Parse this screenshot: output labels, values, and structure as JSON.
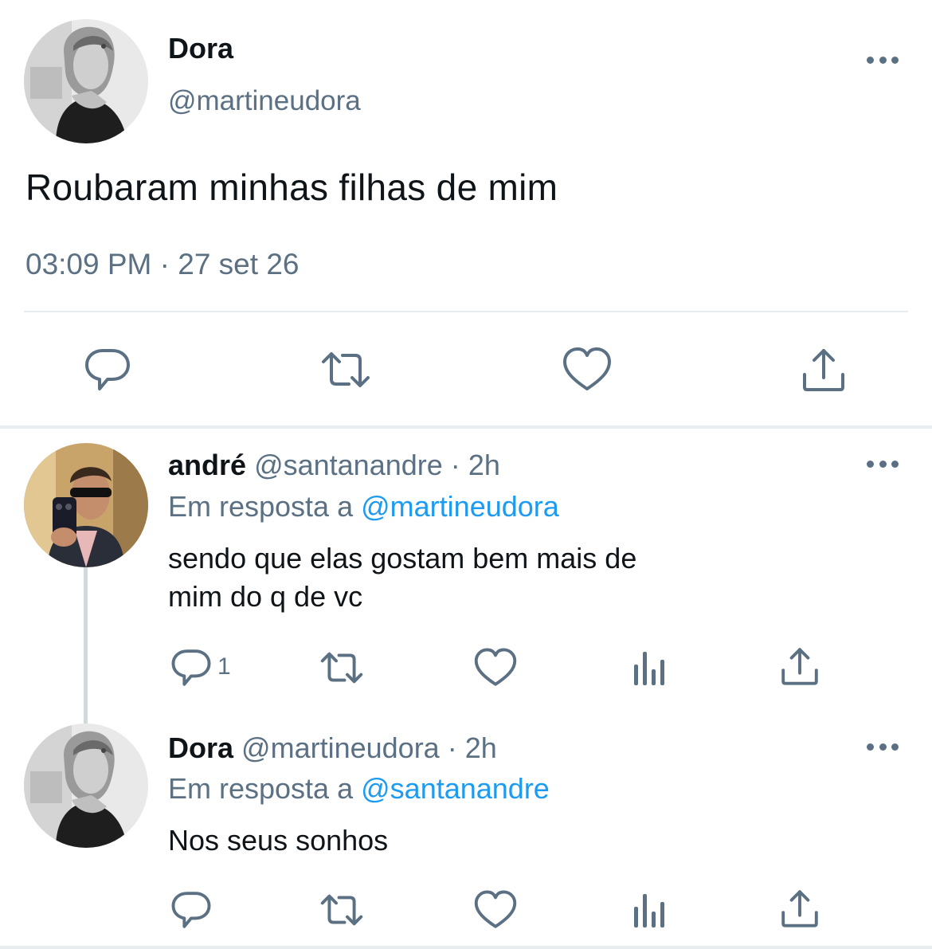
{
  "main_tweet": {
    "name": "Dora",
    "handle": "@martineudora",
    "text": "Roubaram minhas filhas de mim",
    "meta": "03:09 PM · 27 set 26",
    "actions": [
      "reply-icon",
      "retweet-icon",
      "like-icon",
      "share-icon"
    ]
  },
  "replies": [
    {
      "name": "andré",
      "handle": "@santanandre",
      "sep": "·",
      "time": "2h",
      "reply_prefix": "Em resposta a",
      "reply_to": "@martineudora",
      "text_lines": [
        "sendo que elas gostam bem mais de",
        "mim do q de vc"
      ],
      "reply_count": "1"
    },
    {
      "name": "Dora",
      "handle": "@martineudora",
      "sep": "·",
      "time": "2h",
      "reply_prefix": "Em resposta a",
      "reply_to": "@santanandre",
      "text_lines": [
        "Nos seus sonhos"
      ],
      "reply_count": ""
    }
  ],
  "colors": {
    "text": "#0f1419",
    "muted": "#5b7083",
    "link": "#1d9bf0",
    "divider": "#e6ecf0"
  }
}
